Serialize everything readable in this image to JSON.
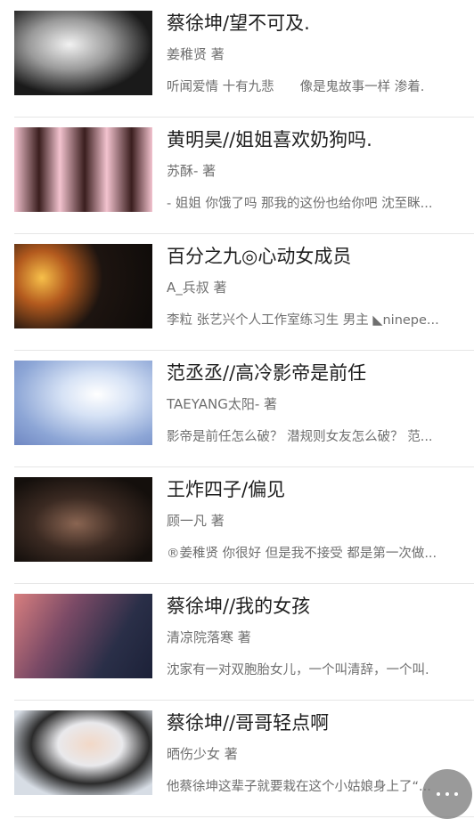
{
  "books": [
    {
      "title": "蔡徐坤/望不可及.",
      "author": "姜稚贤 著",
      "summary": "听闻爱情 十有九悲　　像是鬼故事一样 渗着.",
      "cover_colors": [
        "#111111",
        "#e8e8e8"
      ]
    },
    {
      "title": "黄明昊//姐姐喜欢奶狗吗.",
      "author": "苏酥- 著",
      "summary": "- 姐姐 你饿了吗 那我的这份也给你吧 沈至眯...",
      "cover_colors": [
        "#3a1e1e",
        "#f1b6c4"
      ]
    },
    {
      "title": "百分之九◎心动女成员",
      "author": "A_兵叔 著",
      "summary": "李粒 张艺兴个人工作室练习生 男主 ◣ninepe...",
      "cover_colors": [
        "#1d1410",
        "#d99a3a"
      ]
    },
    {
      "title": "范丞丞//高冷影帝是前任",
      "author": "TAEYANG太阳- 著",
      "summary": "影帝是前任怎么破？ 潜规则女友怎么破？ 范...",
      "cover_colors": [
        "#9fb4da",
        "#ffffff"
      ]
    },
    {
      "title": "王炸四子/偏见",
      "author": "顾一凡 著",
      "summary": "®姜稚贤 你很好 但是我不接受 都是第一次做...",
      "cover_colors": [
        "#140f0c",
        "#7a5a45"
      ]
    },
    {
      "title": "蔡徐坤//我的女孩",
      "author": "清凉院落寒 著",
      "summary": "沈家有一对双胞胎女儿，一个叫清辞，一个叫.",
      "cover_colors": [
        "#2a2f48",
        "#c46a6a"
      ]
    },
    {
      "title": "蔡徐坤//哥哥轻点啊",
      "author": "晒伤少女 著",
      "summary": "他蔡徐坤这辈子就要栽在这个小姑娘身上了“...",
      "cover_colors": [
        "#d7dde5",
        "#2b2b2b"
      ]
    }
  ],
  "fab_icon": "more-dots-icon"
}
